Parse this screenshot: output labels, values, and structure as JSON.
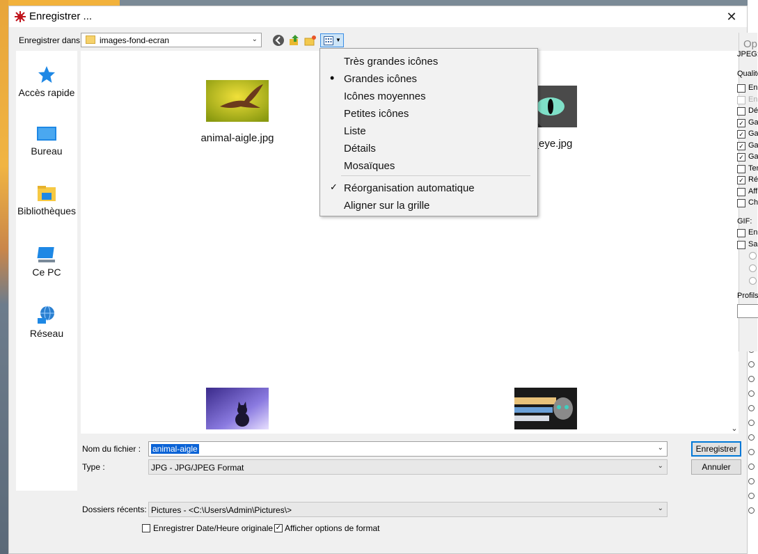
{
  "window": {
    "title": "Enregistrer ...",
    "close_glyph": "✕"
  },
  "toolbar": {
    "save_in_label": "Enregistrer dans :",
    "save_in_value": "images-fond-ecran",
    "chevron": "⌄"
  },
  "places": [
    {
      "label": "Accès rapide",
      "icon": "star-icon"
    },
    {
      "label": "Bureau",
      "icon": "desktop-icon"
    },
    {
      "label": "Bibliothèques",
      "icon": "libraries-icon"
    },
    {
      "label": "Ce PC",
      "icon": "computer-icon"
    },
    {
      "label": "Réseau",
      "icon": "network-icon"
    }
  ],
  "files": [
    {
      "name": "animal-aigle.jpg"
    },
    {
      "name": "cat_eye.jpg"
    },
    {
      "name": ""
    },
    {
      "name": ""
    }
  ],
  "view_menu": {
    "items": [
      {
        "label": "Très grandes icônes",
        "mark": ""
      },
      {
        "label": "Grandes icônes",
        "mark": "•"
      },
      {
        "label": "Icônes moyennes",
        "mark": ""
      },
      {
        "label": "Petites icônes",
        "mark": ""
      },
      {
        "label": "Liste",
        "mark": ""
      },
      {
        "label": "Détails",
        "mark": ""
      },
      {
        "label": "Mosaïques",
        "mark": ""
      }
    ],
    "options": [
      {
        "label": "Réorganisation automatique",
        "mark": "✓"
      },
      {
        "label": "Aligner sur la grille",
        "mark": ""
      }
    ]
  },
  "form": {
    "filename_label": "Nom du fichier :",
    "filename_value": "animal-aigle",
    "type_label": "Type :",
    "type_value": "JPG - JPG/JPEG Format",
    "recent_label": "Dossiers récents:",
    "recent_value": "Pictures  -  <C:\\Users\\Admin\\Pictures\\>",
    "save_button": "Enregistrer",
    "cancel_button": "Annuler",
    "keep_date_label": "Enregistrer Date/Heure originale",
    "keep_date_checked": false,
    "show_options_label": "Afficher options de format",
    "show_options_checked": true,
    "checkmark": "✓"
  },
  "options_panel": {
    "title": "Optic",
    "jpeg_label": "JPEG:",
    "quality_label": "Qualité",
    "jpeg_items": [
      "Enr",
      "Enr",
      "Dés",
      "Gar",
      "Gar",
      "Gar",
      "Gar",
      "Ter",
      "Ré",
      "Affi",
      "Cho"
    ],
    "jpeg_checked": [
      false,
      false,
      false,
      true,
      true,
      true,
      true,
      false,
      true,
      false,
      false
    ],
    "gif_label": "GIF:",
    "gif_items": [
      "Enr",
      "Sau"
    ],
    "profiles_label": "Profils"
  }
}
